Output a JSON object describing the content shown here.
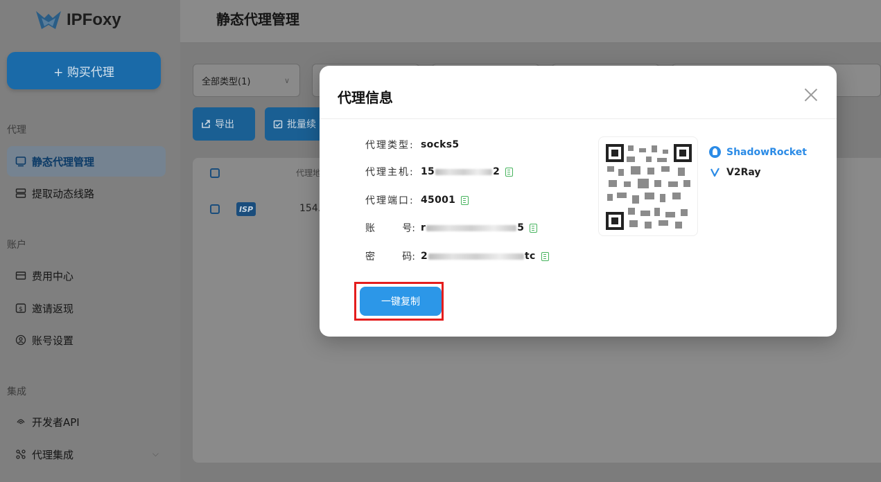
{
  "app": {
    "name": "IPFoxy"
  },
  "sidebar": {
    "buy_button": "+ 购买代理",
    "sections": [
      {
        "title": "代理"
      },
      {
        "title": "账户"
      },
      {
        "title": "集成"
      }
    ],
    "items": [
      {
        "label": "静态代理管理",
        "icon": "monitor-icon",
        "active": true
      },
      {
        "label": "提取动态线路",
        "icon": "server-icon"
      },
      {
        "label": "费用中心",
        "icon": "wallet-icon"
      },
      {
        "label": "邀请返现",
        "icon": "dollar-icon"
      },
      {
        "label": "账号设置",
        "icon": "user-icon"
      },
      {
        "label": "开发者API",
        "icon": "fingerprint-icon"
      },
      {
        "label": "代理集成",
        "icon": "integration-icon"
      }
    ]
  },
  "header": {
    "title": "静态代理管理"
  },
  "filters": {
    "type_select": "全部类型(1)"
  },
  "toolbar": {
    "export_label": "导出",
    "batch_label": "批量续"
  },
  "table": {
    "header_col": "代理地",
    "row": {
      "tag": "ISP",
      "ip_partial": "154."
    }
  },
  "modal": {
    "title": "代理信息",
    "fields": [
      {
        "label": "代理类型:",
        "value": "socks5"
      },
      {
        "label": "代理主机:",
        "value_prefix": "15",
        "value_suffix": "2"
      },
      {
        "label": "代理端口:",
        "value": "45001"
      },
      {
        "label_a": "账",
        "label_b": "号:",
        "value_prefix": "r",
        "value_suffix": "5"
      },
      {
        "label_a": "密",
        "label_b": "码:",
        "value_prefix": "2",
        "value_suffix": "tc"
      }
    ],
    "apps": [
      {
        "name": "ShadowRocket",
        "color": "#2b8be6"
      },
      {
        "name": "V2Ray",
        "color": "#222222"
      }
    ],
    "copy_all": "一键复制"
  },
  "colors": {
    "accent": "#2c97e8",
    "highlight": "#e41d1d",
    "copy_icon": "#45b35c"
  }
}
